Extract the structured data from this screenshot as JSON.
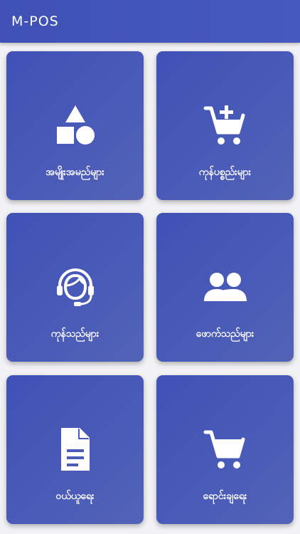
{
  "app": {
    "title": "M-POS"
  },
  "colors": {
    "app_bar": "#3f51b5",
    "card": "#4a5bb8",
    "background": "#f2f2f4",
    "text": "#ffffff"
  },
  "menu": [
    {
      "label": "အမျိုးအမည်များ",
      "icon": "shapes-icon"
    },
    {
      "label": "ကုန်ပစ္စည်းများ",
      "icon": "add-shopping-cart-icon"
    },
    {
      "label": "ကုန်သည်များ",
      "icon": "support-agent-icon"
    },
    {
      "label": "ဖောက်သည်များ",
      "icon": "people-icon"
    },
    {
      "label": "ဝယ်ယူရေး",
      "icon": "document-icon"
    },
    {
      "label": "ရောင်းချရေး",
      "icon": "shopping-cart-icon"
    }
  ]
}
